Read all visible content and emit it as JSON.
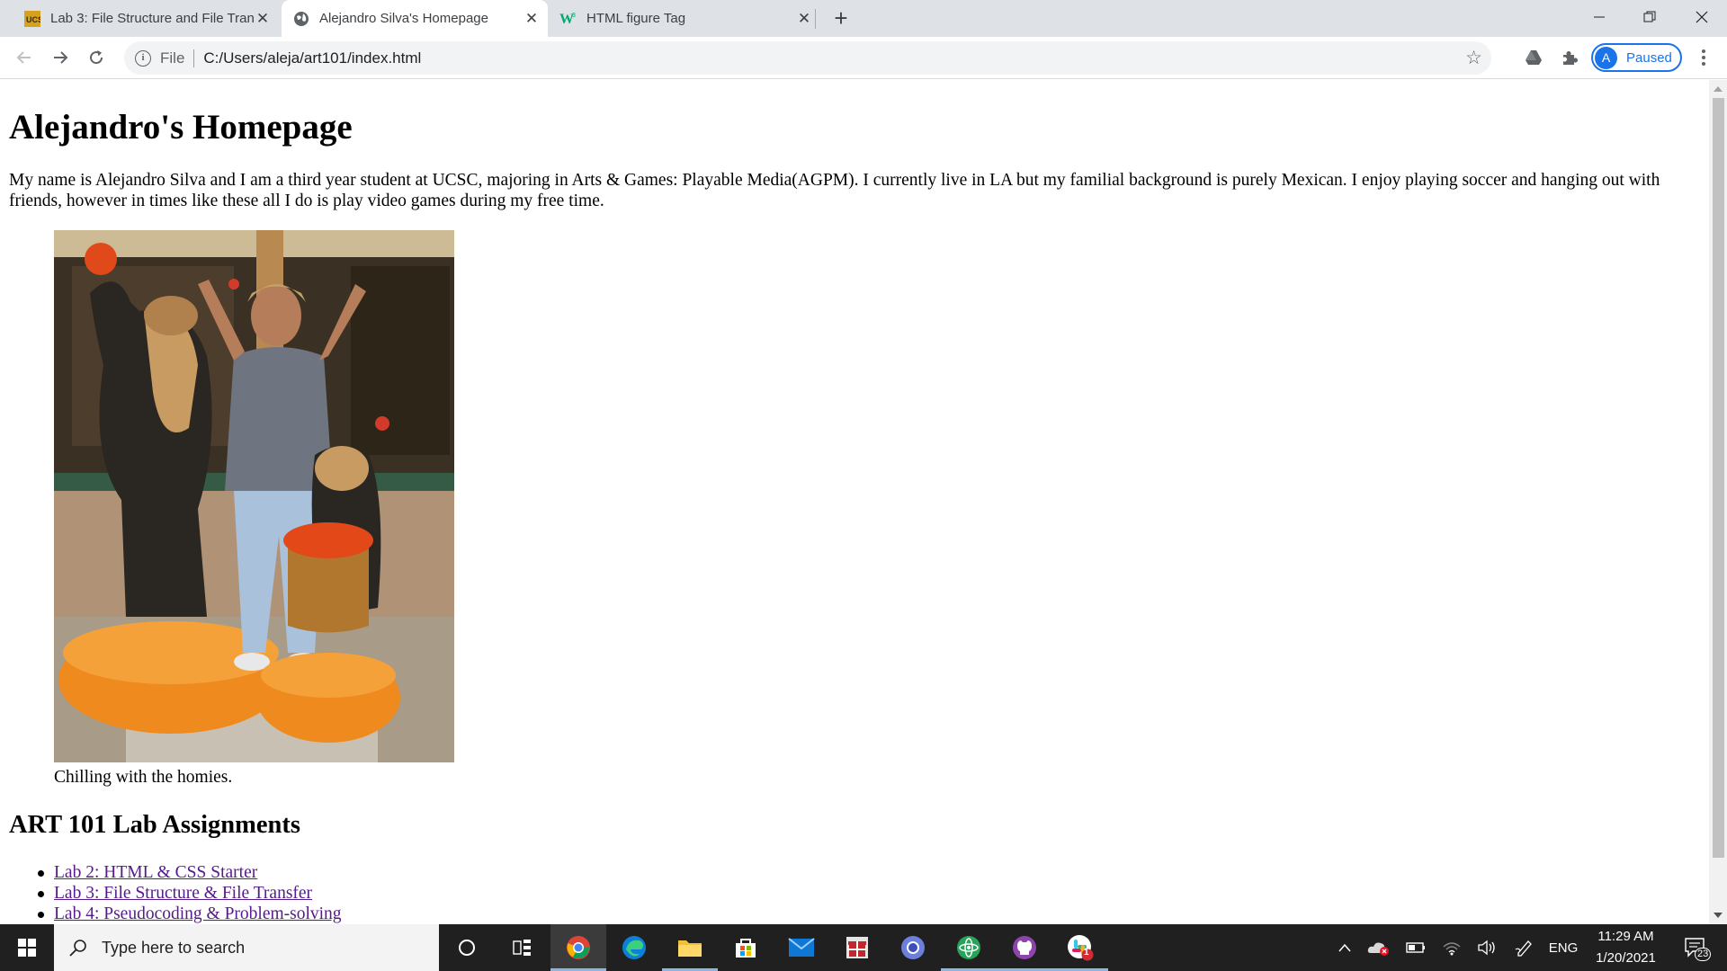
{
  "browser": {
    "tabs": [
      {
        "title": "Lab 3: File Structure and File Tran",
        "icon": "ucsc-favicon-icon"
      },
      {
        "title": "Alejandro Silva's Homepage",
        "icon": "globe-icon"
      },
      {
        "title": "HTML figure Tag",
        "icon": "w3schools-favicon-icon"
      }
    ],
    "active_tab": 1,
    "address": {
      "scheme": "File",
      "url": "C:/Users/aleja/art101/index.html"
    },
    "profile": {
      "initial": "A",
      "label": "Paused"
    }
  },
  "page": {
    "heading": "Alejandro's Homepage",
    "intro": "My name is Alejandro Silva and I am a third year student at UCSC, majoring in Arts & Games: Playable Media(AGPM). I currently live in LA but my familial background is purely Mexican. I enjoy playing soccer and hanging out with friends, however in times like these all I do is play video games during my free time.",
    "figure_caption": "Chilling with the homies.",
    "labs_heading": "ART 101 Lab Assignments",
    "labs": [
      "Lab 2: HTML & CSS Starter",
      "Lab 3: File Structure & File Transfer",
      "Lab 4: Pseudocoding & Problem-solving"
    ]
  },
  "taskbar": {
    "search_placeholder": "Type here to search",
    "language": "ENG",
    "time": "11:29 AM",
    "date": "1/20/2021",
    "notifications": "23",
    "slack_badge": "1"
  },
  "colors": {
    "link_visited": "#551a8b",
    "accent": "#1a73e8",
    "taskbar": "#202020"
  }
}
